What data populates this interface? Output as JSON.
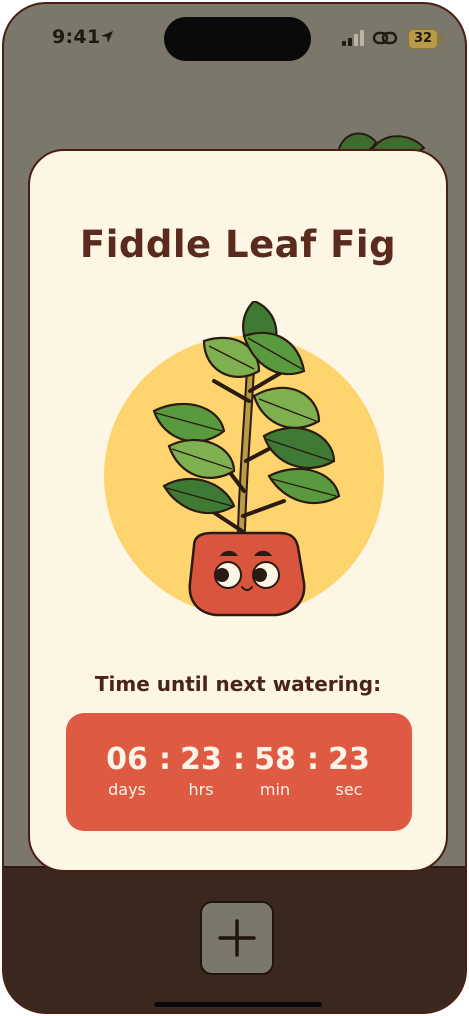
{
  "status_bar": {
    "time": "9:41",
    "battery_level": "32",
    "icons": [
      "location-arrow-icon",
      "signal-icon",
      "link-icon",
      "battery-icon"
    ]
  },
  "plant_card": {
    "title": "Fiddle Leaf Fig",
    "countdown_label": "Time until next watering:",
    "countdown": {
      "days": "06",
      "days_label": "days",
      "hours": "23",
      "hours_label": "hrs",
      "minutes": "58",
      "minutes_label": "min",
      "seconds": "23",
      "seconds_label": "sec",
      "separator": ":"
    }
  },
  "toolbar": {
    "add_icon": "plus-icon"
  },
  "colors": {
    "background": "#7b776a",
    "card": "#fdf6e5",
    "title": "#5a2a1e",
    "countdown_bg": "#df5a43",
    "sun": "#fdd46d",
    "pot": "#d9553e",
    "leaf": "#7fb04f",
    "bottom_bar": "#3a271d"
  }
}
